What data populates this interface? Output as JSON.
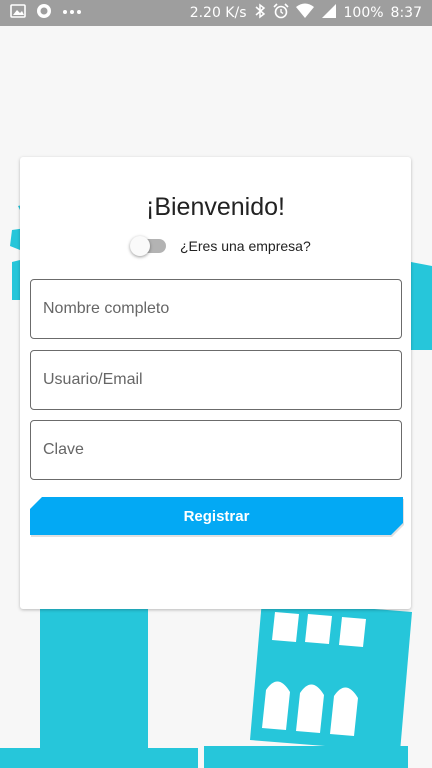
{
  "status_bar": {
    "network_speed": "2.20 K/s",
    "battery": "100%",
    "time": "8:37",
    "icons": [
      "image-icon",
      "circle-app-icon",
      "more-dots-icon",
      "bluetooth-icon",
      "alarm-icon",
      "wifi-icon",
      "signal-icon"
    ]
  },
  "form": {
    "title": "¡Bienvenido!",
    "toggle_label": "¿Eres una empresa?",
    "toggle_on": false,
    "name_placeholder": "Nombre completo",
    "name_value": "",
    "user_placeholder": "Usuario/Email",
    "user_value": "",
    "password_placeholder": "Clave",
    "password_value": "",
    "submit_label": "Registrar"
  },
  "colors": {
    "accent": "#03a9f4",
    "illustration": "#26c6da",
    "status_bar": "#9e9e9e"
  }
}
